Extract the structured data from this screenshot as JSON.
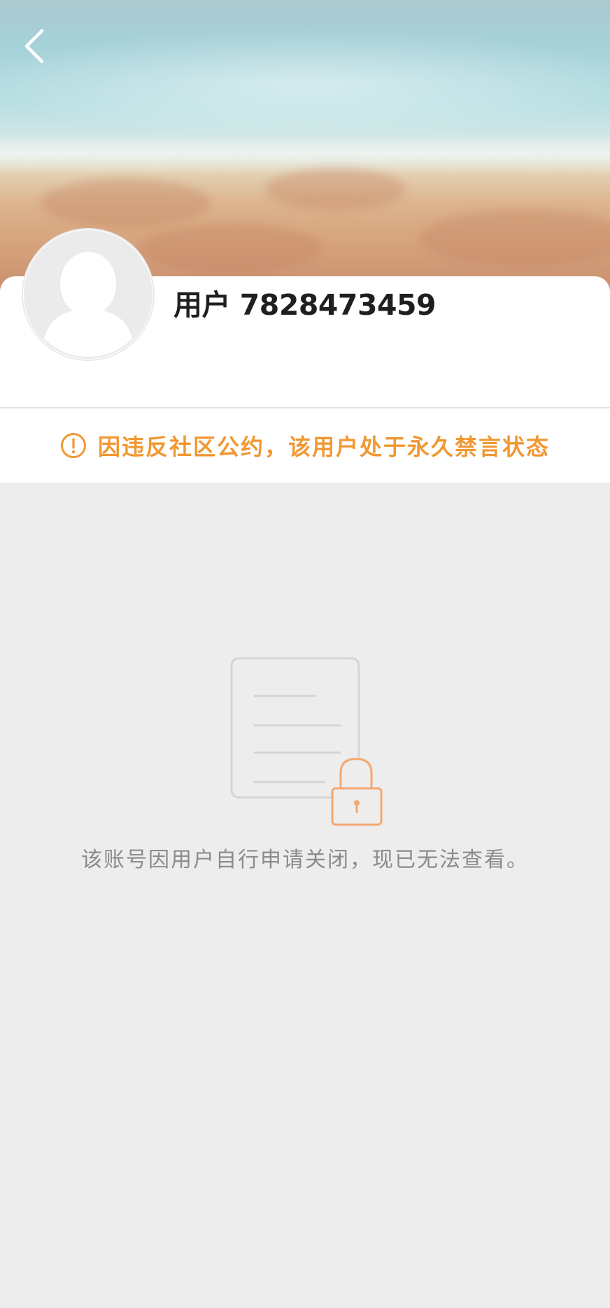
{
  "header": {
    "back_icon": "chevron-left-icon"
  },
  "profile": {
    "username": "用户 7828473459",
    "avatar_icon": "default-avatar-icon"
  },
  "notice": {
    "icon": "exclamation-circle-icon",
    "text": "因违反社区公约，该用户处于永久禁言状态",
    "color": "#f09833"
  },
  "empty_state": {
    "icon": "locked-document-icon",
    "message": "该账号因用户自行申请关闭，现已无法查看。"
  },
  "colors": {
    "background": "#ededed",
    "accent_orange": "#f09833",
    "text_dark": "#1f1f1f",
    "text_muted": "#8b8b8b"
  }
}
